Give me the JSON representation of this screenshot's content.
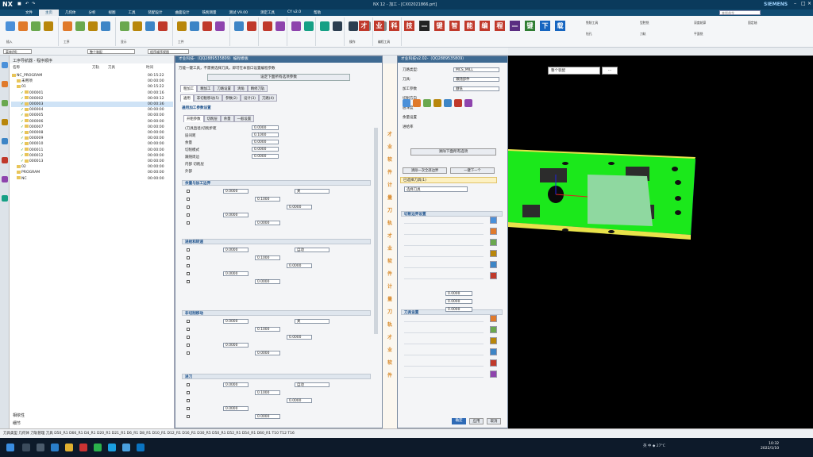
{
  "titlebar": {
    "app": "NX",
    "center": "NX 12 - 加工 - [CX02021866.prt]",
    "brand": "SIEMENS"
  },
  "menubar": {
    "items": [
      "文件",
      "主页",
      "几何体",
      "分析",
      "视图",
      "工具",
      "装配设计",
      "曲面设计",
      "铣削测量",
      "测试 V9.00",
      "测定工具",
      "CY v2.0",
      "帮助"
    ],
    "active": 1
  },
  "search": {
    "placeholder": "查找命令"
  },
  "ribbon": {
    "group_labels": [
      "插入",
      "工序",
      "显示",
      "工件",
      "",
      "",
      "",
      "",
      "操作",
      "编程工具"
    ],
    "tiles": [
      {
        "char": "才",
        "color": "#c0392b"
      },
      {
        "char": "业",
        "color": "#c0392b"
      },
      {
        "char": "科",
        "color": "#c0392b"
      },
      {
        "char": "技",
        "color": "#c0392b"
      },
      {
        "char": "—",
        "color": "#222222"
      },
      {
        "char": "键",
        "color": "#c0392b"
      },
      {
        "char": "智",
        "color": "#c0392b"
      },
      {
        "char": "能",
        "color": "#c0392b"
      },
      {
        "char": "编",
        "color": "#c0392b"
      },
      {
        "char": "程",
        "color": "#c0392b"
      },
      {
        "char": "—",
        "color": "#5a2d82"
      },
      {
        "char": "键",
        "color": "#2e7d32"
      },
      {
        "char": "下",
        "color": "#1565c0"
      },
      {
        "char": "载",
        "color": "#1565c0"
      }
    ],
    "right_labels": [
      "铣削工具",
      "型腔铣",
      "深度轮廓",
      "固定轴",
      "钻孔",
      "刀轨",
      "平面铣"
    ]
  },
  "subtool": {
    "combo1": "菜单(M)",
    "combo2": "整个装配",
    "combo3": "程序顺序视图"
  },
  "navigator": {
    "title": "工序导航器 - 程序顺序",
    "columns": [
      "名称",
      "刀轨",
      "刀具",
      "时间"
    ],
    "rows": [
      {
        "indent": 0,
        "name": "NC_PROGRAM",
        "check": false,
        "time": "00:15:22"
      },
      {
        "indent": 1,
        "name": "未用项",
        "check": false,
        "time": "00:00:00"
      },
      {
        "indent": 1,
        "name": "01",
        "check": false,
        "time": "00:15:22"
      },
      {
        "indent": 2,
        "name": "000001",
        "check": true,
        "time": "00:00:16"
      },
      {
        "indent": 2,
        "name": "000002",
        "check": true,
        "time": "00:00:12"
      },
      {
        "indent": 2,
        "name": "000003",
        "check": true,
        "time": "00:00:36",
        "selected": true
      },
      {
        "indent": 2,
        "name": "000004",
        "check": true,
        "time": "00:00:00"
      },
      {
        "indent": 2,
        "name": "000005",
        "check": true,
        "time": "00:00:00"
      },
      {
        "indent": 2,
        "name": "000006",
        "check": true,
        "time": "00:00:00"
      },
      {
        "indent": 2,
        "name": "000007",
        "check": true,
        "time": "00:00:00"
      },
      {
        "indent": 2,
        "name": "000008",
        "check": true,
        "time": "00:00:00"
      },
      {
        "indent": 2,
        "name": "000009",
        "check": true,
        "time": "00:00:00"
      },
      {
        "indent": 2,
        "name": "000010",
        "check": true,
        "time": "00:00:00"
      },
      {
        "indent": 2,
        "name": "000011",
        "check": true,
        "time": "00:00:00"
      },
      {
        "indent": 2,
        "name": "000012",
        "check": true,
        "time": "00:00:00"
      },
      {
        "indent": 2,
        "name": "000013",
        "check": true,
        "time": "00:00:00"
      },
      {
        "indent": 1,
        "name": "02",
        "check": false,
        "time": "00:00:00"
      },
      {
        "indent": 1,
        "name": "PROGRAM",
        "check": false,
        "time": "00:00:00"
      },
      {
        "indent": 1,
        "name": "NC",
        "check": false,
        "time": "00:00:00"
      }
    ],
    "bottom": [
      "相依性",
      "细节"
    ]
  },
  "dlg1": {
    "title": "才业科技-（QQ2889535809）编程模板",
    "hint": "万能一键工具，不需要选择刀具，即可在本窗口设置编程参数",
    "main_btn": "设定下面所有选项参数",
    "tabs1": [
      "粗加工",
      "精加工",
      "刀路设置",
      "清角",
      "精修刀轨"
    ],
    "tabs2": [
      "通用",
      "非切削移动(5)",
      "参数(2)",
      "设计(3)",
      "刀路(4)"
    ],
    "tabs3": [
      "开粗参数",
      "切削层",
      "余量",
      "一般设置"
    ],
    "sec1": "通用加工参数设置",
    "lines": [
      "(刀具直径)切削步距",
      "层间距",
      "余量",
      "切削模式",
      "跟随周边",
      "内部 切削层",
      "外部"
    ],
    "opt_fields": [
      "0.0000",
      "0.1000",
      "0.0000",
      "0.0000",
      "0.0000"
    ],
    "sec2": "余量与加工边界",
    "sec3": "进给和转速",
    "sec4": "非切削移动",
    "sec5": "进刀",
    "combo_a": "关",
    "combo_b": "自动"
  },
  "orange": [
    "才",
    "业",
    "软",
    "件",
    "计",
    "量",
    "刀",
    "轨",
    "才",
    "业",
    "软",
    "件",
    "计",
    "量",
    "刀",
    "轨",
    "才",
    "业",
    "软",
    "件"
  ],
  "dlg2": {
    "title": "才业科技v2.02-（QQ2889535809）",
    "rows": [
      "刀路类型:",
      "刀具:",
      "加工参数",
      "切削方向",
      "层深度",
      "余量设置",
      "进给率"
    ],
    "combo1": "MCS_MILL",
    "combo2": "跟随部件",
    "combo3": "顺铣",
    "main_btn": "清除下面所有选项",
    "sub_btn1": "清除一次全部边界",
    "sub_btn2": "一键下一个",
    "yellow": "已选择刀具(1)",
    "yellow2": "选择刀具",
    "sec1": "切削边界设置",
    "sec2": "刀具设置",
    "ok": "确定",
    "apply": "应用",
    "cancel": "取消",
    "fields": [
      "0.0000",
      "0.0000",
      "0.0000"
    ]
  },
  "viewport": {
    "combo": "整个装配",
    "dots": "···"
  },
  "statusbar": "刀具类型  几何体  刀轨管理  刀具  D50_R1  D66_R1  D4_R1  D20_R1  D21_R1  D6_R1  D8_R1  D10_R1  D12_R1  D16_R1  D30_R5  D50_R1  D52_R1  D54_R1  D60_R1  T10  T12  T16",
  "taskbar": {
    "time": "10:32",
    "date": "2022/1/10",
    "tray": "英 中 ◆ 27°C"
  },
  "colors": {
    "title": "#0a3a5c",
    "menu": "#114c73",
    "part_green": "#1be81b",
    "part_yellow": "#e8e24a",
    "accent": "#2f6bb6"
  }
}
